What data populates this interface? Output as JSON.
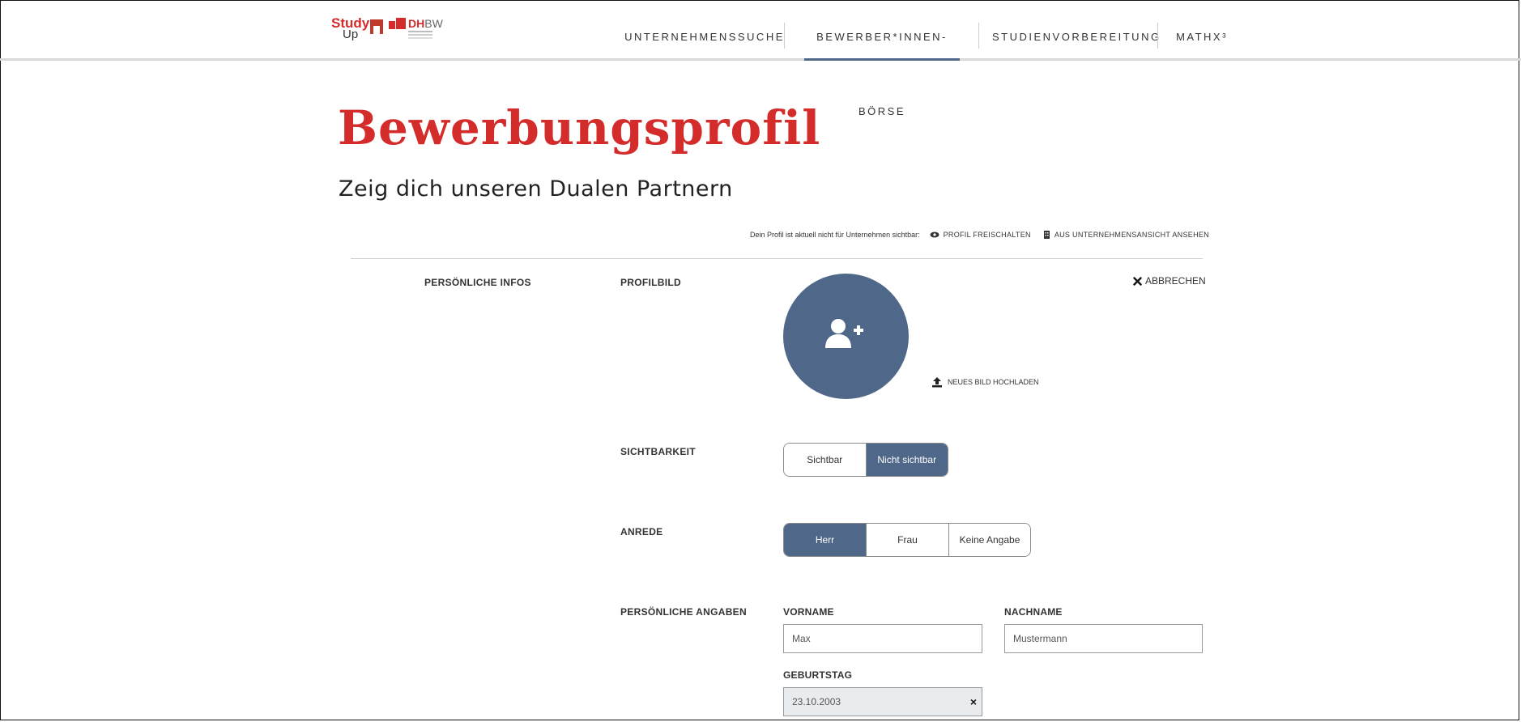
{
  "header": {
    "logo_study_top": "Study",
    "logo_study_bottom": "Up",
    "logo_dhbw_main": "DH",
    "logo_dhbw_rest": "BW",
    "nav": [
      {
        "label": "UNTERNEHMENSSUCHE"
      },
      {
        "label": "BEWERBER*INNEN-BÖRSE",
        "active": true
      },
      {
        "label": "STUDIENVORBEREITUNG"
      },
      {
        "label": "MATHX³"
      }
    ]
  },
  "page": {
    "title": "Bewerbungsprofil",
    "subtitle": "Zeig dich unseren Dualen Partnern",
    "status_text": "Dein Profil ist aktuell nicht für Unternehmen sichtbar:",
    "unlock_label": "PROFIL FREISCHALTEN",
    "company_view_label": "AUS UNTERNEHMENSANSICHT ANSEHEN"
  },
  "section": {
    "left_label": "PERSÖNLICHE INFOS",
    "cancel_label": "ABBRECHEN",
    "profile_picture_label": "PROFILBILD",
    "upload_label": "NEUES BILD HOCHLADEN",
    "visibility_label": "SICHTBARKEIT",
    "visibility_options": [
      "Sichtbar",
      "Nicht sichtbar"
    ],
    "visibility_selected": "Nicht sichtbar",
    "salutation_label": "ANREDE",
    "salutation_options": [
      "Herr",
      "Frau",
      "Keine Angabe"
    ],
    "salutation_selected": "Herr",
    "personal_label": "PERSÖNLICHE ANGABEN",
    "first_name_label": "VORNAME",
    "first_name_value": "Max",
    "last_name_label": "NACHNAME",
    "last_name_value": "Mustermann",
    "birthday_label": "GEBURTSTAG",
    "birthday_value": "23.10.2003",
    "clear_symbol": "×"
  },
  "colors": {
    "brand_red": "#d42b2b",
    "accent_blue": "#4f6788"
  }
}
